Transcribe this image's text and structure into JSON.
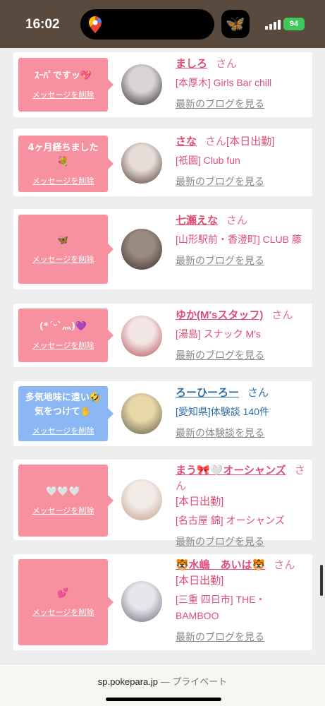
{
  "status": {
    "time": "16:02",
    "battery": "94"
  },
  "entries": [
    {
      "message": "ｽｰﾊﾟですッ💖",
      "delete_label": "メッセージを削除",
      "name": "ましろ",
      "honorific": "さん",
      "extra": "",
      "shop": "[本厚木] Girls Bar chill",
      "link": "最新のブログを見る",
      "theme": "pink",
      "avatar_colors": [
        "#d8d4d8",
        "#2b2426"
      ]
    },
    {
      "message": "4ヶ月経ちました💐",
      "delete_label": "メッセージを削除",
      "name": "さな",
      "honorific": "さん",
      "extra": "[本日出勤]",
      "shop": "[祇園] Club fun",
      "link": "最新のブログを見る",
      "theme": "pink",
      "avatar_colors": [
        "#e8dcd8",
        "#4a3530"
      ]
    },
    {
      "message": "🦋",
      "delete_label": "メッセージを削除",
      "name": "七瀬えな",
      "honorific": "さん",
      "extra": "",
      "shop": "[山形駅前・香澄町] CLUB 藤",
      "link": "最新のブログを見る",
      "theme": "pink",
      "avatar_colors": [
        "#9a8a80",
        "#3a2e2a"
      ]
    },
    {
      "message": "(*ˊᵕˋ灬)💜",
      "delete_label": "メッセージを削除",
      "name": "ゆか(M'sスタッフ)",
      "honorific": "さん",
      "extra": "",
      "shop": "[湯島] スナック M's",
      "link": "最新のブログを見る",
      "theme": "pink",
      "avatar_colors": [
        "#f1e6e4",
        "#b84a52"
      ]
    },
    {
      "message": "多気地味に遠い🤣気をつけて✋",
      "delete_label": "メッセージを削除",
      "name": "ろーひーろー",
      "honorific": "さん",
      "extra": "",
      "shop": "[愛知県]体験談 140件",
      "link": "最新の体験談を見る",
      "theme": "blue",
      "avatar_colors": [
        "#e8d8a8",
        "#5a5448"
      ]
    },
    {
      "message": "🤍🤍🤍",
      "delete_label": "メッセージを削除",
      "name": "まう🎀🤍オーシャンズ",
      "honorific": "さん",
      "extra": "[本日出勤]",
      "shop": "[名古屋 錦] オーシャンズ",
      "link": "最新のブログを見る",
      "theme": "pink",
      "avatar_colors": [
        "#f2ece8",
        "#c49a86"
      ]
    },
    {
      "message": "💕",
      "delete_label": "メッセージを削除",
      "name": "🐯水嶋　あいは🐯",
      "honorific": "さん",
      "extra": "[本日出勤]",
      "shop": "[三重 四日市] THE・BAMBOO",
      "link": "最新のブログを見る",
      "theme": "pink",
      "avatar_colors": [
        "#e6e6ec",
        "#6a6878"
      ]
    }
  ],
  "url_bar": {
    "domain": "sp.pokepara.jp",
    "suffix": "— プライベート"
  }
}
